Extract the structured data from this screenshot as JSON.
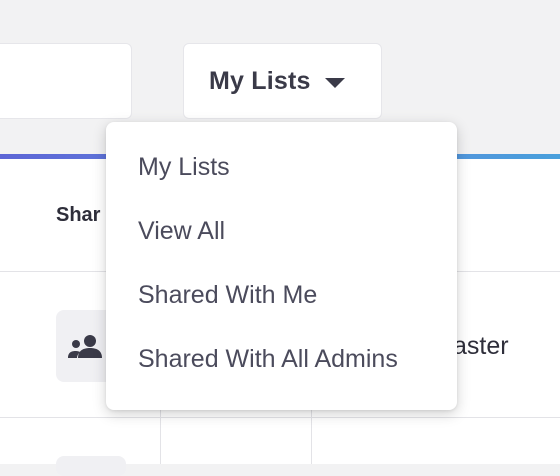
{
  "toolbar": {
    "lists_dropdown_label": "My Lists"
  },
  "table": {
    "column_header_fragment": "Shar",
    "row_name_fragment": "aster"
  },
  "menu": {
    "items": [
      {
        "label": "My Lists"
      },
      {
        "label": "View All"
      },
      {
        "label": "Shared With Me"
      },
      {
        "label": "Shared With All Admins"
      }
    ]
  },
  "colors": {
    "accent_start": "#5d66d6",
    "accent_end": "#49a0dc",
    "text": "#3a3a48"
  },
  "icons": {
    "share": "group-users-icon",
    "caret": "caret-down-icon"
  }
}
